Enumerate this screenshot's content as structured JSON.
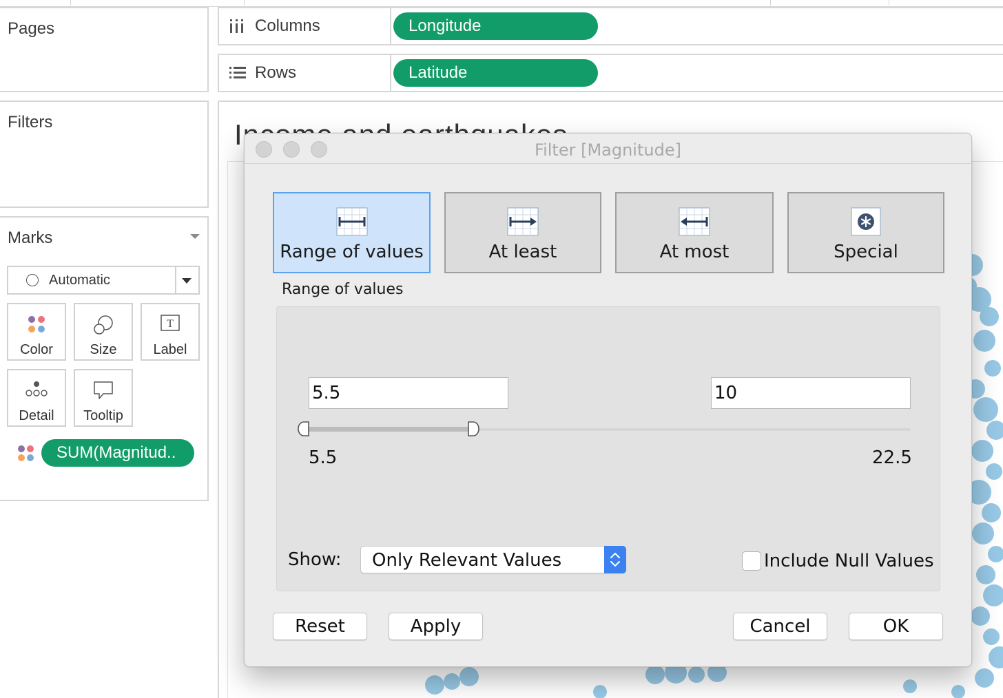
{
  "left_panel": {
    "pages_title": "Pages",
    "filters_title": "Filters",
    "marks_title": "Marks",
    "mark_type": "Automatic",
    "mark_buttons": {
      "color": "Color",
      "size": "Size",
      "label": "Label",
      "detail": "Detail",
      "tooltip": "Tooltip"
    },
    "mark_pill": "SUM(Magnitud.."
  },
  "shelves": {
    "columns_label": "Columns",
    "columns_pill": "Longitude",
    "rows_label": "Rows",
    "rows_pill": "Latitude"
  },
  "view": {
    "title": "Income and earthquakes"
  },
  "dialog": {
    "title": "Filter [Magnitude]",
    "modes": {
      "range": "Range of values",
      "at_least": "At least",
      "at_most": "At most",
      "special": "Special"
    },
    "active_mode": "Range of values",
    "section_label": "Range of values",
    "min_value": "5.5",
    "max_value": "10",
    "range_min": "5.5",
    "range_max": "22.5",
    "show_label": "Show:",
    "show_value": "Only Relevant Values",
    "include_null_label": "Include Null Values",
    "include_null_checked": false,
    "buttons": {
      "reset": "Reset",
      "apply": "Apply",
      "cancel": "Cancel",
      "ok": "OK"
    }
  },
  "colors": {
    "pill_green": "#119c69",
    "active_mode_bg": "#cfe4fb",
    "active_mode_border": "#5aa2ee",
    "select_stepper": "#3b82f0",
    "map_marks": "#8cc3e3"
  }
}
